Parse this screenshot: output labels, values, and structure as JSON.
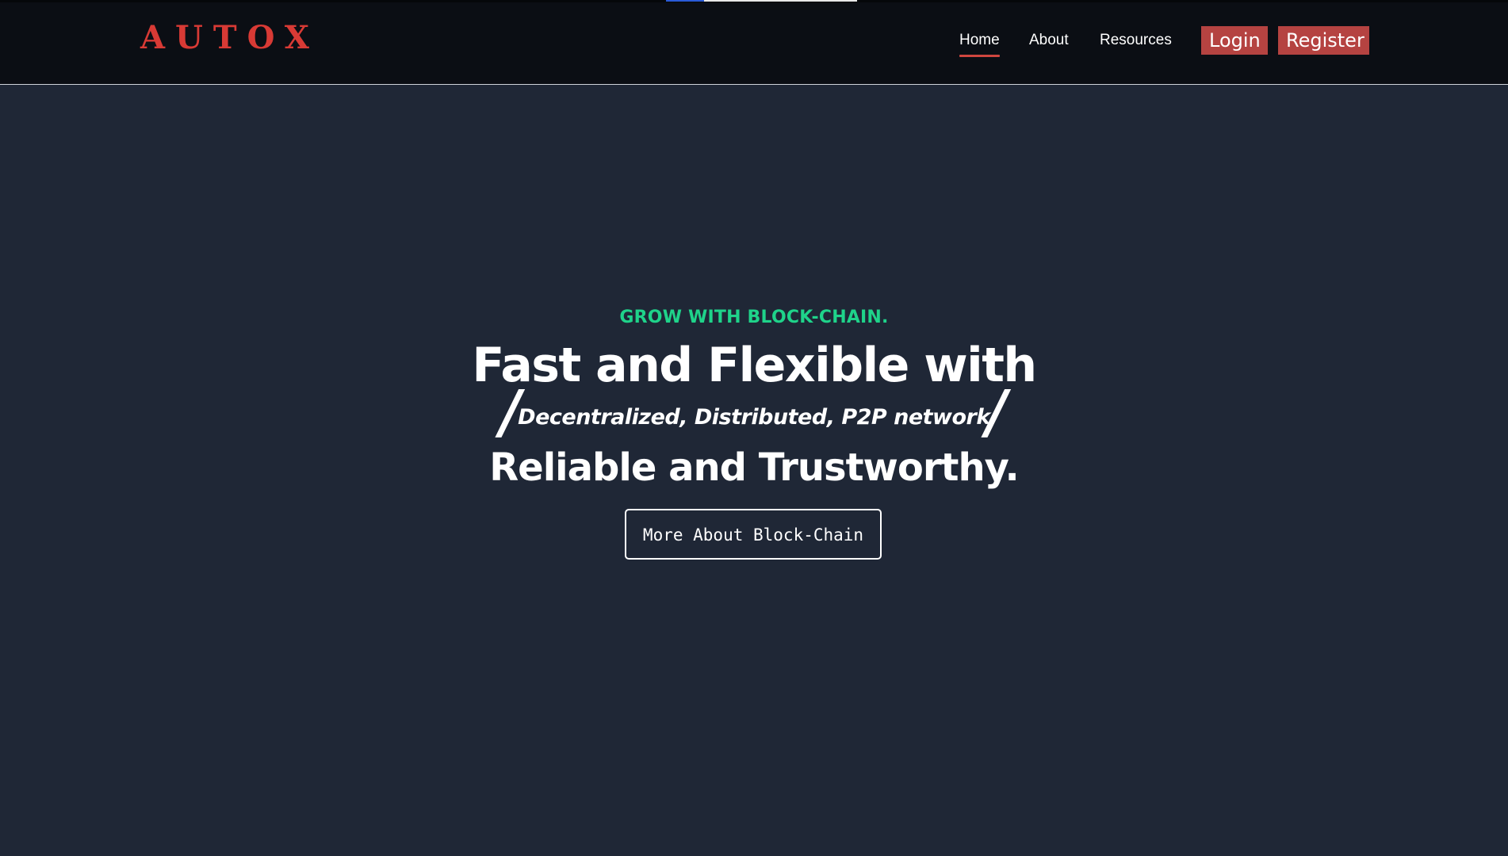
{
  "header": {
    "logo": "AUTOX",
    "nav": {
      "home": "Home",
      "about": "About",
      "resources": "Resources"
    },
    "auth": {
      "login": "Login",
      "register": "Register"
    }
  },
  "hero": {
    "eyebrow": "GROW WITH BLOCK-CHAIN.",
    "headline": "Fast and Flexible with",
    "slash": "/",
    "typed_text": "Decentralized, Distributed, P2P network",
    "subheadline": "Reliable and Trustworthy.",
    "cta_label": "More About Block-Chain"
  },
  "colors": {
    "brand": "#d83a35",
    "accent_green": "#1fd38a",
    "header_bg": "#0b0e14",
    "page_bg": "#1f2736",
    "button_bg": "#b54341"
  }
}
